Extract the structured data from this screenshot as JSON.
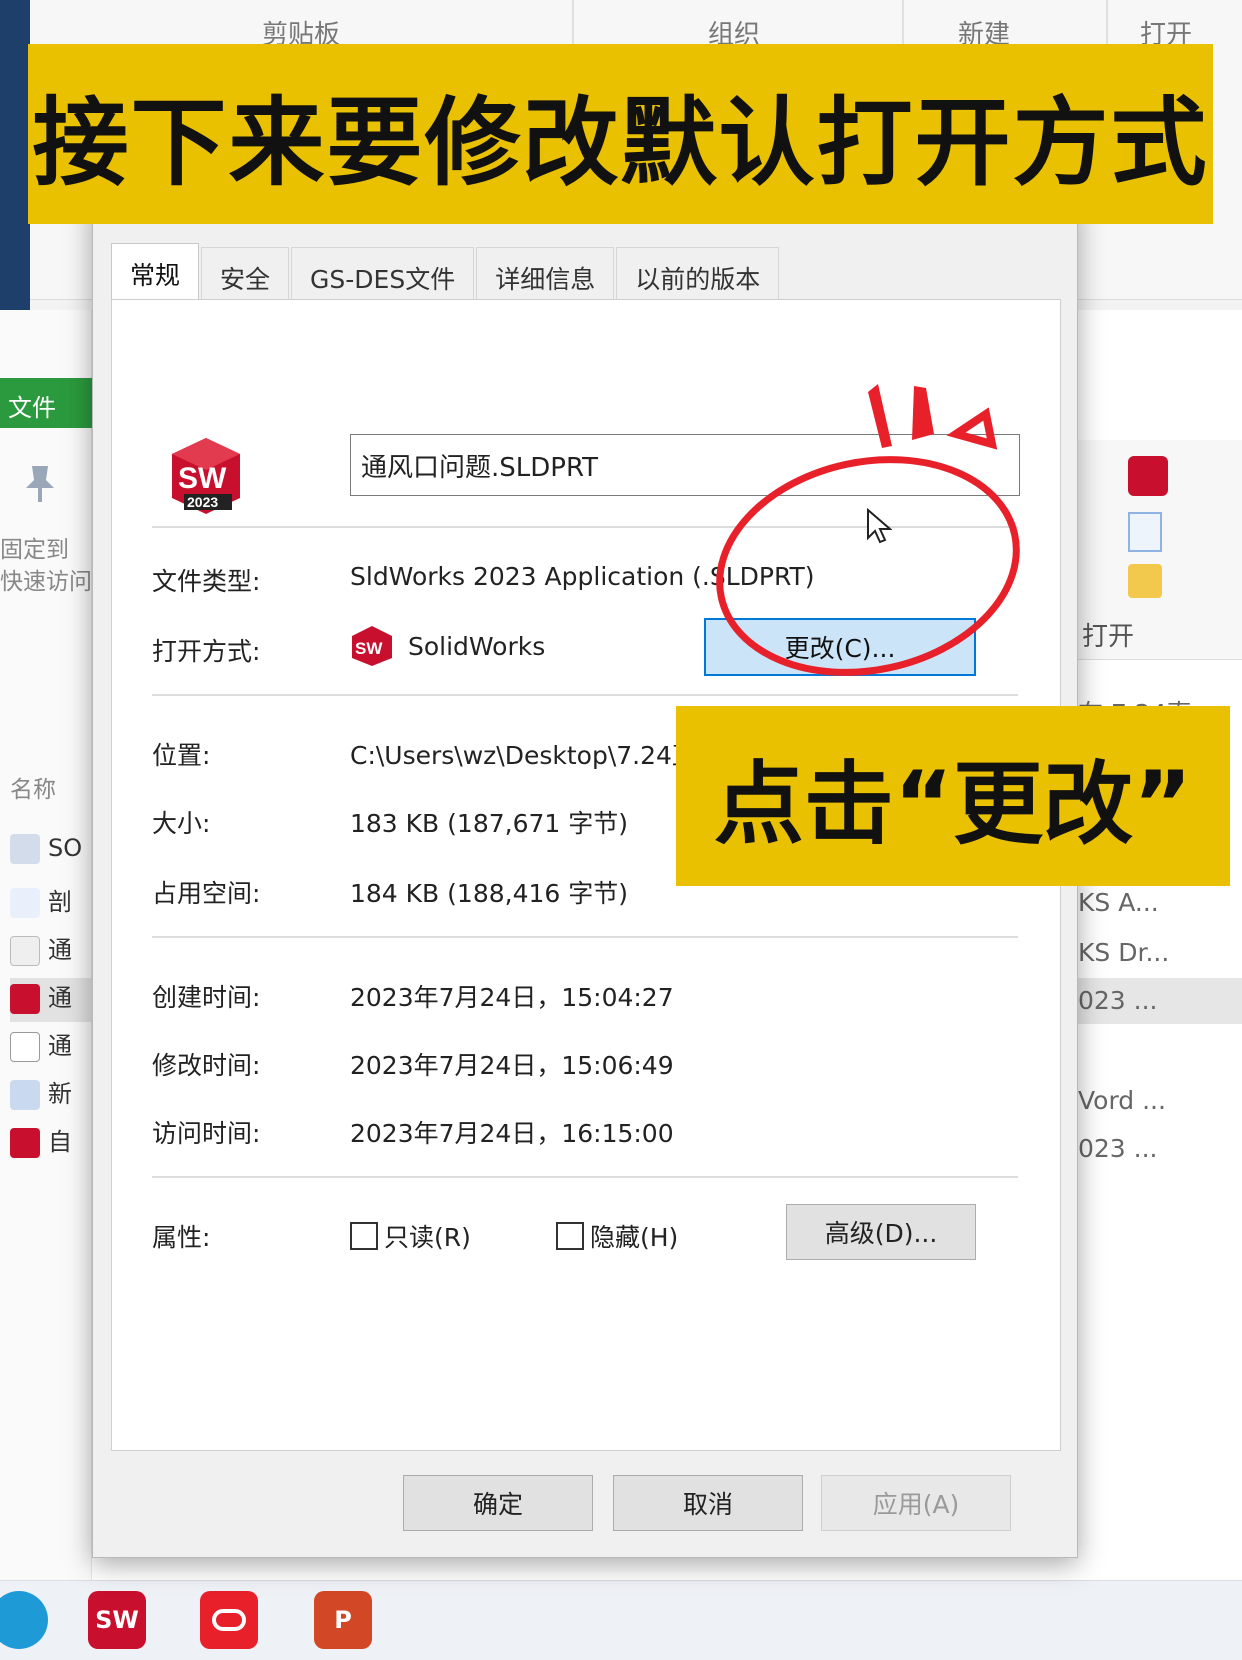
{
  "background": {
    "ribbon_labels": [
      "剪贴板",
      "组织",
      "新建",
      "打开"
    ],
    "left_panel": {
      "file_tab": "文件",
      "pin_label_1": "固定到",
      "pin_label_2": "快速访问",
      "name_header": "名称"
    },
    "list_items": [
      "SO",
      "剖",
      "通",
      "通",
      "通",
      "新",
      "自"
    ],
    "right_toolbar_label": "打开",
    "right_search": "在 7.24直",
    "right_rows": [
      "KS A...",
      "KS Dr...",
      "023 ...",
      "Vord ...",
      "023 ..."
    ]
  },
  "dialog": {
    "tabs": [
      "常规",
      "安全",
      "GS-DES文件",
      "详细信息",
      "以前的版本"
    ],
    "file_name": "通风口问题.SLDPRT",
    "file_type_label": "文件类型:",
    "file_type_value": "SldWorks 2023 Application (.SLDPRT)",
    "open_with_label": "打开方式:",
    "open_with_value": "SolidWorks",
    "change_button": "更改(C)...",
    "location_label": "位置:",
    "location_value": "C:\\Users\\wz\\Desktop\\7.24直播",
    "size_label": "大小:",
    "size_value": "183 KB (187,671 字节)",
    "disk_size_label": "占用空间:",
    "disk_size_value": "184 KB (188,416 字节)",
    "created_label": "创建时间:",
    "created_value": "2023年7月24日，15:04:27",
    "modified_label": "修改时间:",
    "modified_value": "2023年7月24日，15:06:49",
    "accessed_label": "访问时间:",
    "accessed_value": "2023年7月24日，16:15:00",
    "attributes_label": "属性:",
    "readonly_label": "只读(R)",
    "hidden_label": "隐藏(H)",
    "advanced_button": "高级(D)...",
    "ok_button": "确定",
    "cancel_button": "取消",
    "apply_button": "应用(A)",
    "sw_icon_text": "SW",
    "sw_icon_year": "2023"
  },
  "overlays": {
    "top_caption": "接下来要修改默认打开方式",
    "mid_caption": "点击“更改”"
  },
  "colors": {
    "banner": "#e9c100",
    "annotation": "#e8202a",
    "sw_red": "#c8102e",
    "accent_blue": "#0078d7"
  }
}
